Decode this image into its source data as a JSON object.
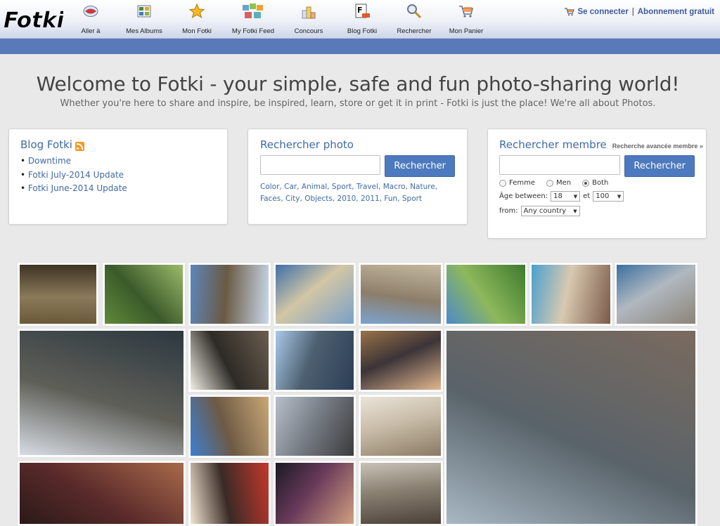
{
  "nav": {
    "logo_text": "Fotki",
    "items": [
      {
        "label": "Aller à",
        "icon": "globe-icon"
      },
      {
        "label": "Mes Albums",
        "icon": "albums-icon"
      },
      {
        "label": "Mon Fotki",
        "icon": "star-icon"
      },
      {
        "label": "My Fotki Feed",
        "icon": "feed-icon"
      },
      {
        "label": "Concours",
        "icon": "podium-icon"
      },
      {
        "label": "Blog Fotki",
        "icon": "blog-icon"
      },
      {
        "label": "Rechercher",
        "icon": "magnifier-icon"
      },
      {
        "label": "Mon Panier",
        "icon": "cart-icon"
      }
    ],
    "login": "Se connecter",
    "separator": "|",
    "subscribe": "Abonnement gratuit"
  },
  "hero": {
    "title": "Welcome to Fotki - your simple, safe and fun photo-sharing world!",
    "subtitle": "Whether you're here to share and inspire, be inspired, learn, store or get it in print - Fotki is just the place! We're all about Photos."
  },
  "blog": {
    "title": "Blog Fotki",
    "posts": [
      "Downtime",
      "Fotki July-2014 Update",
      "Fotki June-2014 Update"
    ]
  },
  "photo_search": {
    "title": "Rechercher photo",
    "button": "Rechercher",
    "input_value": "",
    "tags": [
      "Color",
      "Car",
      "Animal",
      "Sport",
      "Travel",
      "Macro",
      "Nature",
      "Faces",
      "City",
      "Objects",
      "2010",
      "2011",
      "Fun",
      "Sport"
    ]
  },
  "member_search": {
    "title": "Rechercher membre",
    "advanced": "Recherche avancée membre »",
    "button": "Rechercher",
    "input_value": "",
    "gender": {
      "female": "Femme",
      "male": "Men",
      "both": "Both",
      "selected": "Both"
    },
    "age_label": "Âge between:",
    "age_min": "18",
    "age_and": "et",
    "age_max": "100",
    "from_label": "from:",
    "country": "Any country"
  },
  "photos": [
    {
      "name": "photo-fish",
      "colors": [
        "#6b5a3a",
        "#3e3424",
        "#8b7a5a"
      ]
    },
    {
      "name": "photo-garden-stream",
      "colors": [
        "#5f8a3a",
        "#9bbb6a",
        "#3b5a2a"
      ]
    },
    {
      "name": "photo-boat-dock",
      "colors": [
        "#5d86b8",
        "#c9d8ea",
        "#6a5a44"
      ]
    },
    {
      "name": "photo-pool-party",
      "colors": [
        "#3e6fa8",
        "#7aa0c8",
        "#d2c6a5"
      ]
    },
    {
      "name": "photo-city-cathedral",
      "colors": [
        "#7ba3d0",
        "#c5b8a0",
        "#8c7e6a"
      ]
    },
    {
      "name": "photo-green-valley",
      "colors": [
        "#4c8ac9",
        "#3d7a2e",
        "#8eb85c"
      ]
    },
    {
      "name": "photo-hotel-pool",
      "colors": [
        "#4aa0cf",
        "#7b5a4a",
        "#d9c9b0"
      ]
    },
    {
      "name": "photo-lake-pier",
      "colors": [
        "#3d6fa0",
        "#8c8478",
        "#b0b8c0"
      ]
    },
    {
      "name": "photo-vintage-truck",
      "colors": [
        "#d8dde4",
        "#2c3840",
        "#5f5f58"
      ]
    },
    {
      "name": "photo-old-portraits",
      "colors": [
        "#f2efe6",
        "#6a5e4e",
        "#2e2a26"
      ]
    },
    {
      "name": "photo-lighthouse",
      "colors": [
        "#a9c9e8",
        "#2c3e56",
        "#4d6070"
      ]
    },
    {
      "name": "photo-baby",
      "colors": [
        "#9a7248",
        "#e2b68e",
        "#3c3438"
      ]
    },
    {
      "name": "photo-street-webcam",
      "colors": [
        "#a8b8c4",
        "#7a6a5e",
        "#59636a"
      ]
    },
    {
      "name": "photo-station-building",
      "colors": [
        "#3d7fd0",
        "#c9a878",
        "#6e5a44"
      ]
    },
    {
      "name": "photo-tape-dispenser",
      "colors": [
        "#b7bfcb",
        "#3a3a3c",
        "#7a8088"
      ]
    },
    {
      "name": "photo-school-sketch",
      "colors": [
        "#eae4d8",
        "#8a7a64",
        "#c8bca8"
      ]
    },
    {
      "name": "photo-friends-night",
      "colors": [
        "#2a1a18",
        "#a86a4a",
        "#5a2a2a"
      ]
    },
    {
      "name": "photo-mercury-ad",
      "colors": [
        "#f1e6d2",
        "#c4382c",
        "#3a2a26"
      ]
    },
    {
      "name": "photo-concert",
      "colors": [
        "#1a1a24",
        "#d0a080",
        "#6a3a5a"
      ]
    },
    {
      "name": "photo-trailer",
      "colors": [
        "#c8c2b6",
        "#4a4038",
        "#8a8072"
      ]
    }
  ]
}
